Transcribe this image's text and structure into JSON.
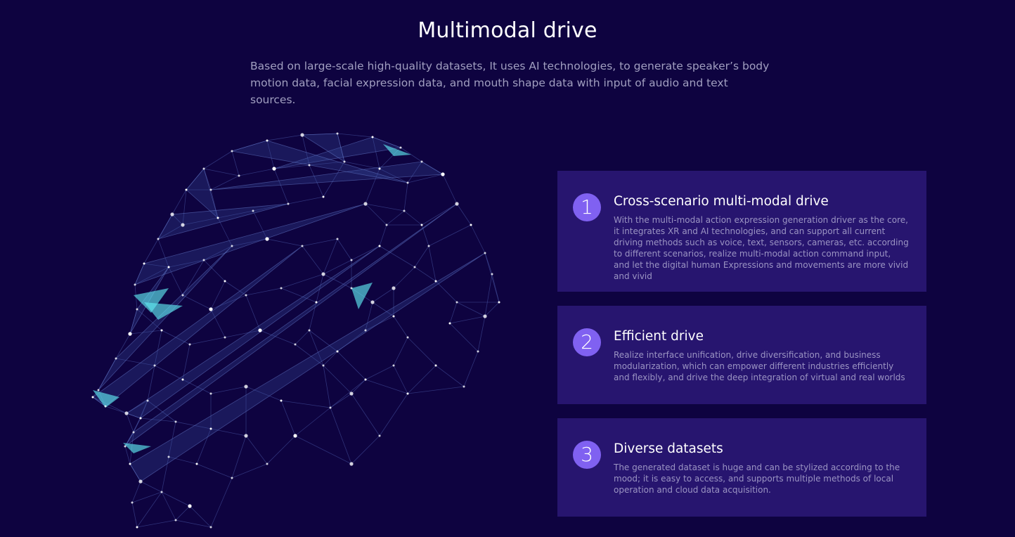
{
  "header": {
    "title": "Multimodal drive",
    "subtitle": "Based on large-scale high-quality datasets, It uses AI technologies, to generate speaker’s body motion data, facial expression data, and mouth shape data with input of audio and text sources."
  },
  "colors": {
    "background": "#0e0340",
    "card": "#27156f",
    "badge": "#8061f1",
    "accent_cyan": "#5fe6f0"
  },
  "features": [
    {
      "number": "1",
      "title": "Cross-scenario multi-modal drive",
      "description": "With the multi-modal action expression generation driver as the core, it integrates XR and AI technologies, and can support all current driving methods such as voice, text, sensors, cameras, etc. according to different scenarios, realize multi-modal action command input, and let the digital human Expressions and movements are more vivid and vivid"
    },
    {
      "number": "2",
      "title": "Efficient drive",
      "description": "Realize interface unification, drive diversification, and business modularization, which can empower different industries efficiently and flexibly, and drive the deep integration of virtual and real worlds"
    },
    {
      "number": "3",
      "title": "Diverse datasets",
      "description": "The generated dataset is huge and can be stylized according to the mood; it is easy to access, and supports multiple methods of local operation and cloud data acquisition."
    }
  ]
}
